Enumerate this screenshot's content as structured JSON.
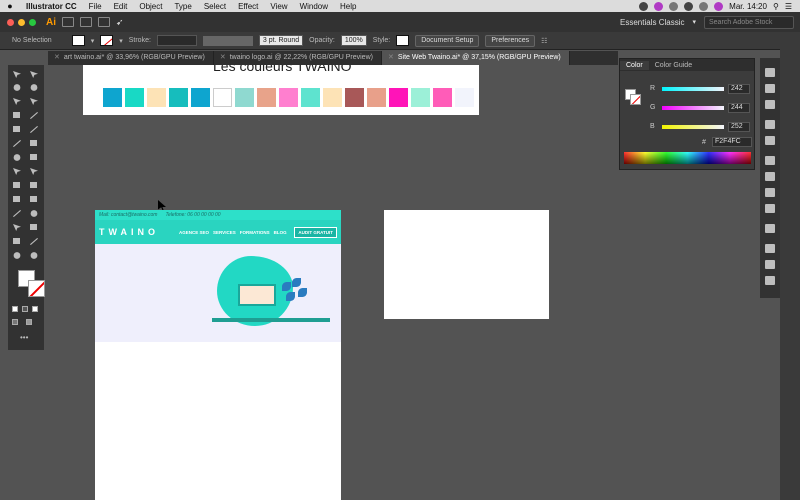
{
  "menubar": {
    "apple": "",
    "app_name": "Illustrator CC",
    "items": [
      "File",
      "Edit",
      "Object",
      "Type",
      "Select",
      "Effect",
      "View",
      "Window",
      "Help"
    ],
    "time": "Mar. 14:20"
  },
  "appbar": {
    "logo": "Ai",
    "workspace": "Essentials Classic",
    "search_placeholder": "Search Adobe Stock"
  },
  "control_bar": {
    "selection": "No Selection",
    "stroke_label": "Stroke:",
    "brush": "3 pt. Round",
    "opacity_label": "Opacity:",
    "opacity_value": "100%",
    "style_label": "Style:",
    "document_setup": "Document Setup",
    "preferences": "Preferences"
  },
  "tabs": [
    {
      "label": "art twaino.ai* @ 33,96% (RGB/GPU Preview)",
      "active": false
    },
    {
      "label": "twaino logo.ai @ 22,22% (RGB/GPU Preview)",
      "active": false
    },
    {
      "label": "Site Web Twaino.ai* @ 37,15% (RGB/GPU Preview)",
      "active": true
    }
  ],
  "artboard1": {
    "title": "Les couleurs TWAINO",
    "colors": [
      "#0ea5cf",
      "#18d9c5",
      "#fde3b6",
      "#16bdbd",
      "#0ea5cf",
      "#ffffff",
      "#8fd9d0",
      "#e8a38a",
      "#ff7fcf",
      "#5ee3cf",
      "#fde3b6",
      "#a85858",
      "#e8a08a",
      "#ff14b8",
      "#9cf0d8",
      "#ff5cb8",
      "#f2f4fc"
    ]
  },
  "site": {
    "top_email": "Mail: contact@twaino.com",
    "top_phone": "Telefone: 06 00 00 00 00",
    "logo": "TWAINO",
    "menu": [
      "AGENCE SEO",
      "SERVICES",
      "FORMATIONS",
      "BLOG"
    ],
    "cta": "AUDIT GRATUIT"
  },
  "color_panel": {
    "tabs": [
      "Color",
      "Color Guide"
    ],
    "r_label": "R",
    "r": "242",
    "g_label": "G",
    "g": "244",
    "b_label": "B",
    "b": "252",
    "hex_label": "#",
    "hex": "F2F4FC"
  },
  "colors": {
    "accent": "#2ad4c0",
    "hero_bg": "#efeffc",
    "app_dark": "#323232",
    "canvas": "#535353"
  }
}
